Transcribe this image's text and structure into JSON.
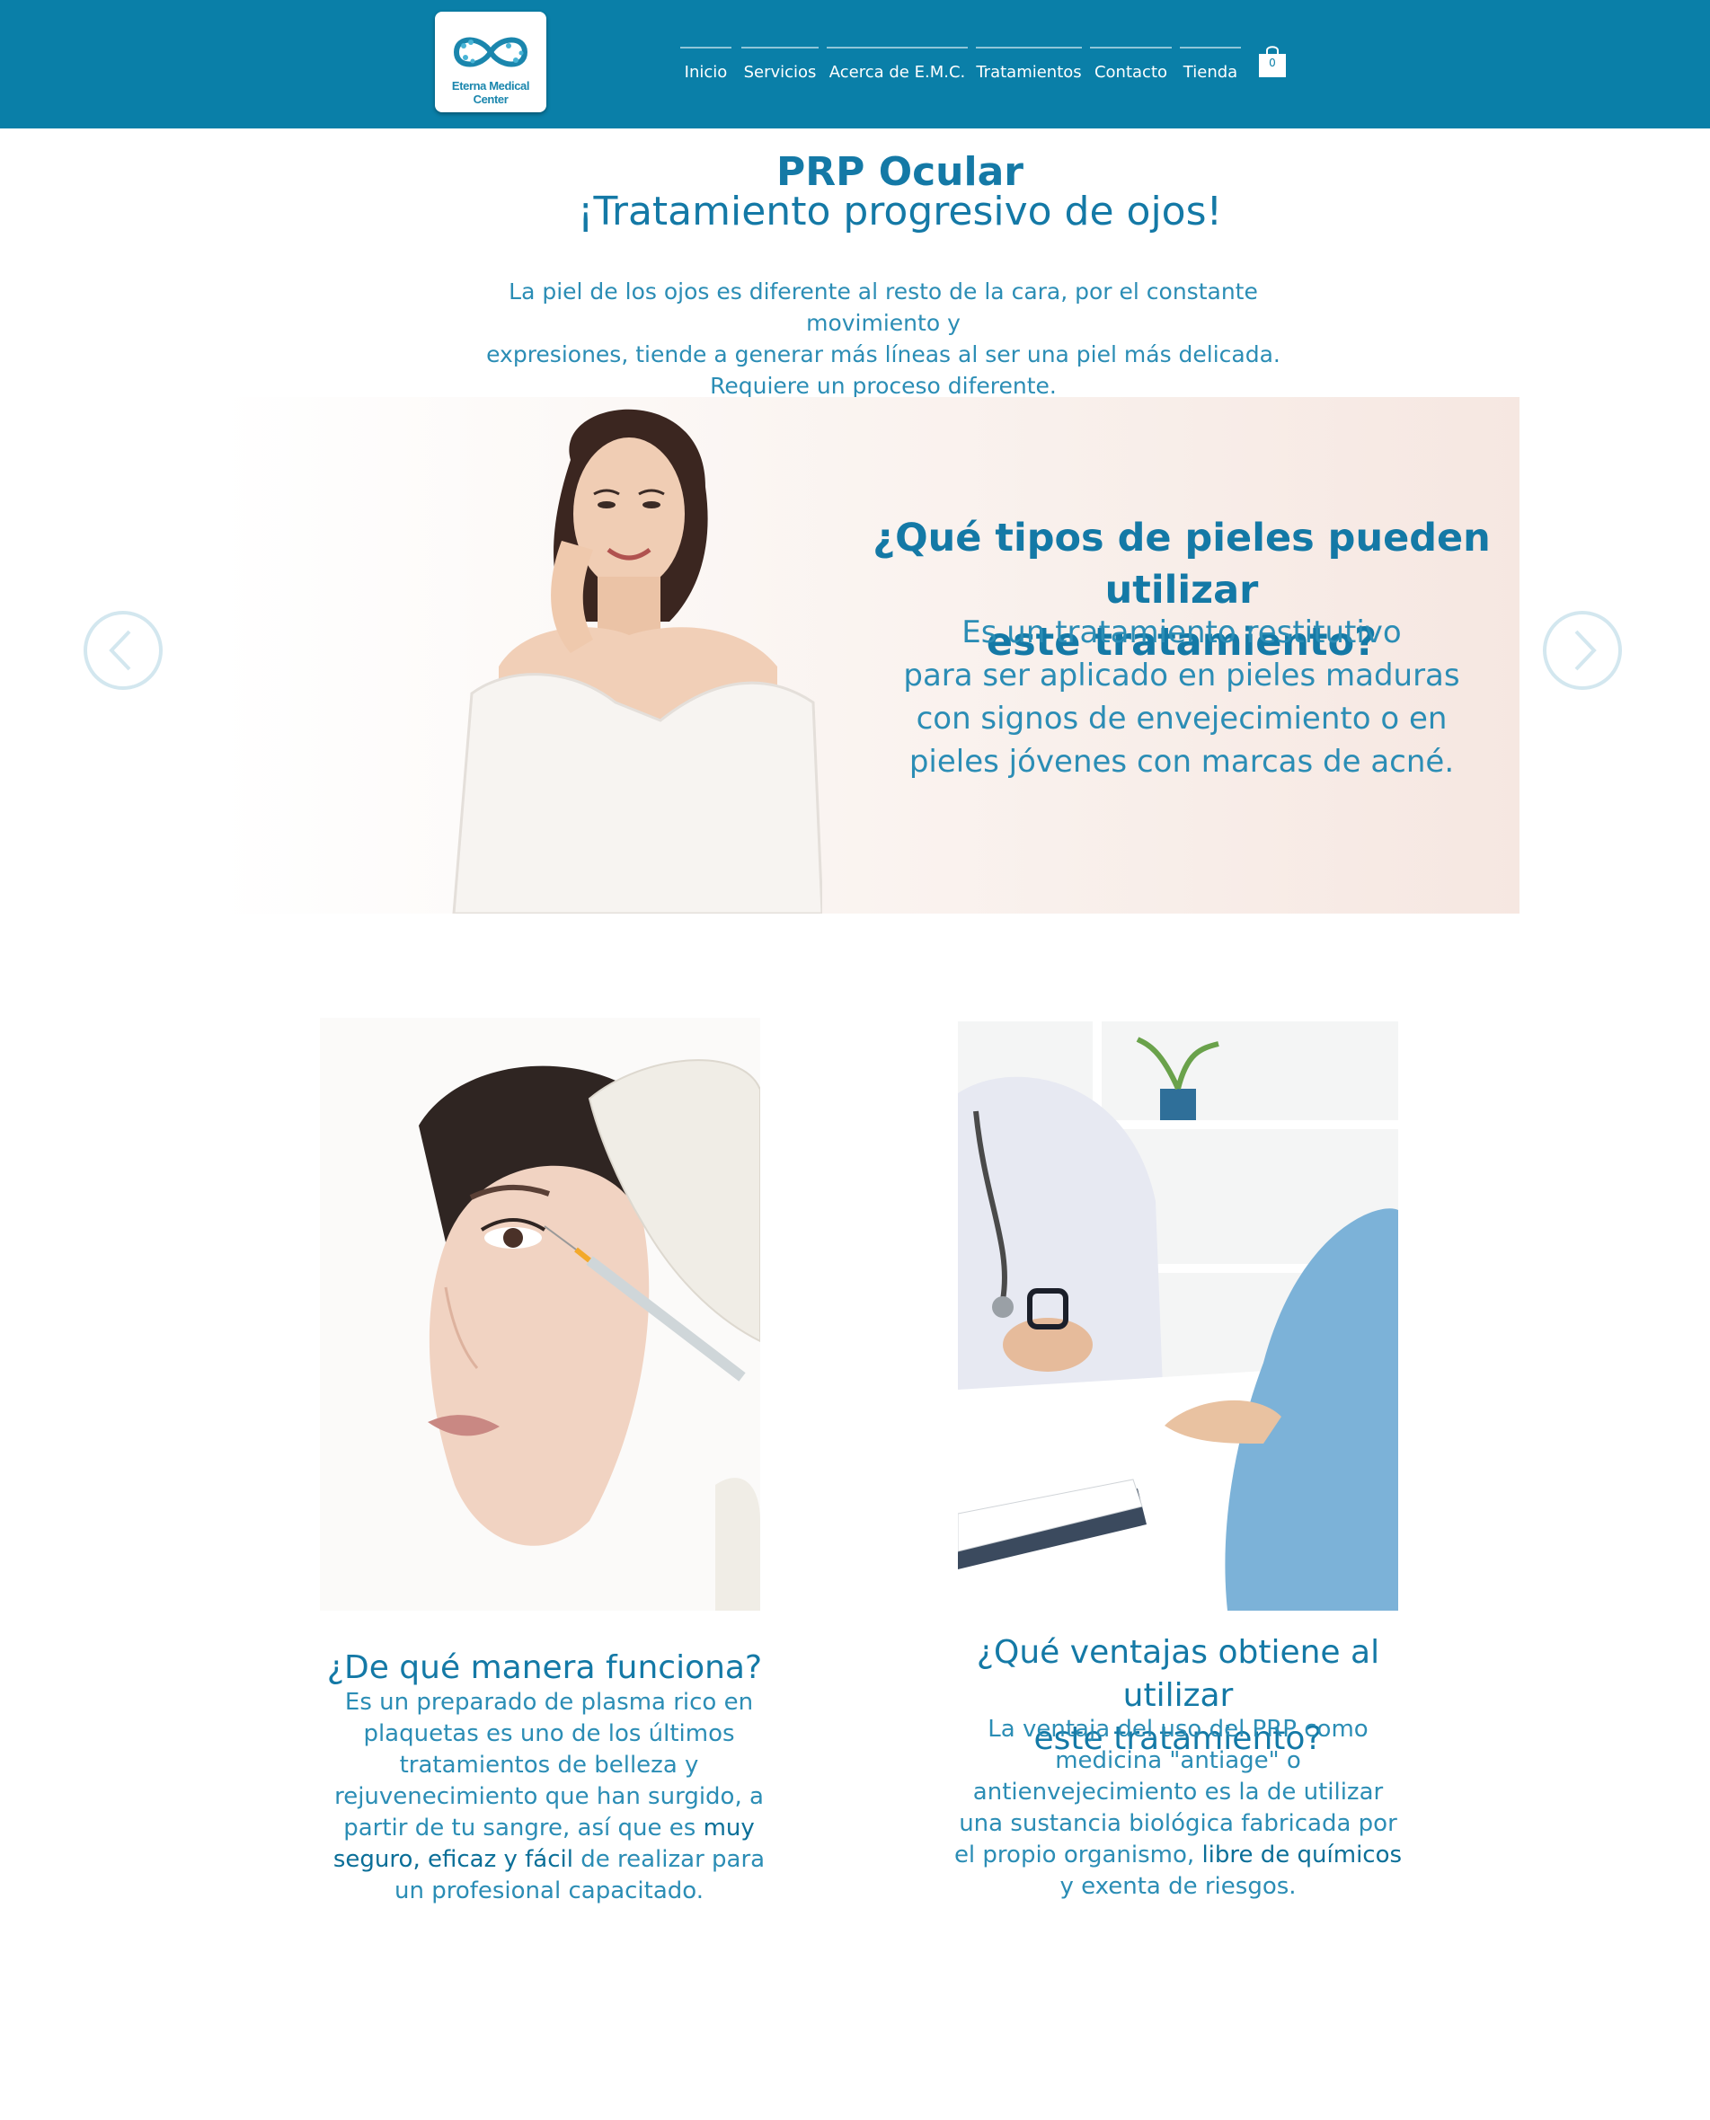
{
  "header": {
    "logo_text": "Eterna Medical Center",
    "nav": [
      "Inicio",
      "Servicios",
      "Acerca de E.M.C.",
      "Tratamientos",
      "Contacto",
      "Tienda"
    ],
    "cart_count": "0",
    "bg_color": "#0a7fa8"
  },
  "hero": {
    "title": "PRP Ocular",
    "subtitle": "¡Tratamiento progresivo de ojos!",
    "intro_lines": [
      "La piel de los ojos es diferente al resto de la cara, por el constante movimiento y",
      "expresiones, tiende a generar más líneas al ser una piel más delicada.",
      "Requiere un proceso diferente."
    ]
  },
  "slider": {
    "heading_lines": [
      "¿Qué tipos de pieles pueden utilizar",
      "este tratamiento?"
    ],
    "text_lines": [
      "Es un tratamiento restitutivo",
      "para ser aplicado en pieles maduras",
      "con signos de envejecimiento o en",
      "pieles jóvenes con marcas de acné."
    ],
    "prev_icon": "chevron-left-icon",
    "next_icon": "chevron-right-icon"
  },
  "card_left": {
    "heading": "¿De qué manera funciona?",
    "text_a": "Es un preparado de plasma rico en plaquetas es uno de los últimos tratamientos de belleza y rejuvenecimiento que han surgido, a partir de tu sangre, así que es ",
    "text_highlight": "muy seguro, eficaz y fácil",
    "text_b": " de realizar para un profesional capacitado."
  },
  "card_right": {
    "heading_lines": [
      "¿Qué ventajas obtiene al utilizar",
      "este tratamiento?"
    ],
    "text_a": "La ventaja del uso del PRP como medicina \"antiage\" o antienvejecimiento es la de utilizar una sustancia biológica fabricada por el propio organismo, ",
    "text_highlight": "libre de químicos",
    "text_b": " y exenta de riesgos."
  }
}
